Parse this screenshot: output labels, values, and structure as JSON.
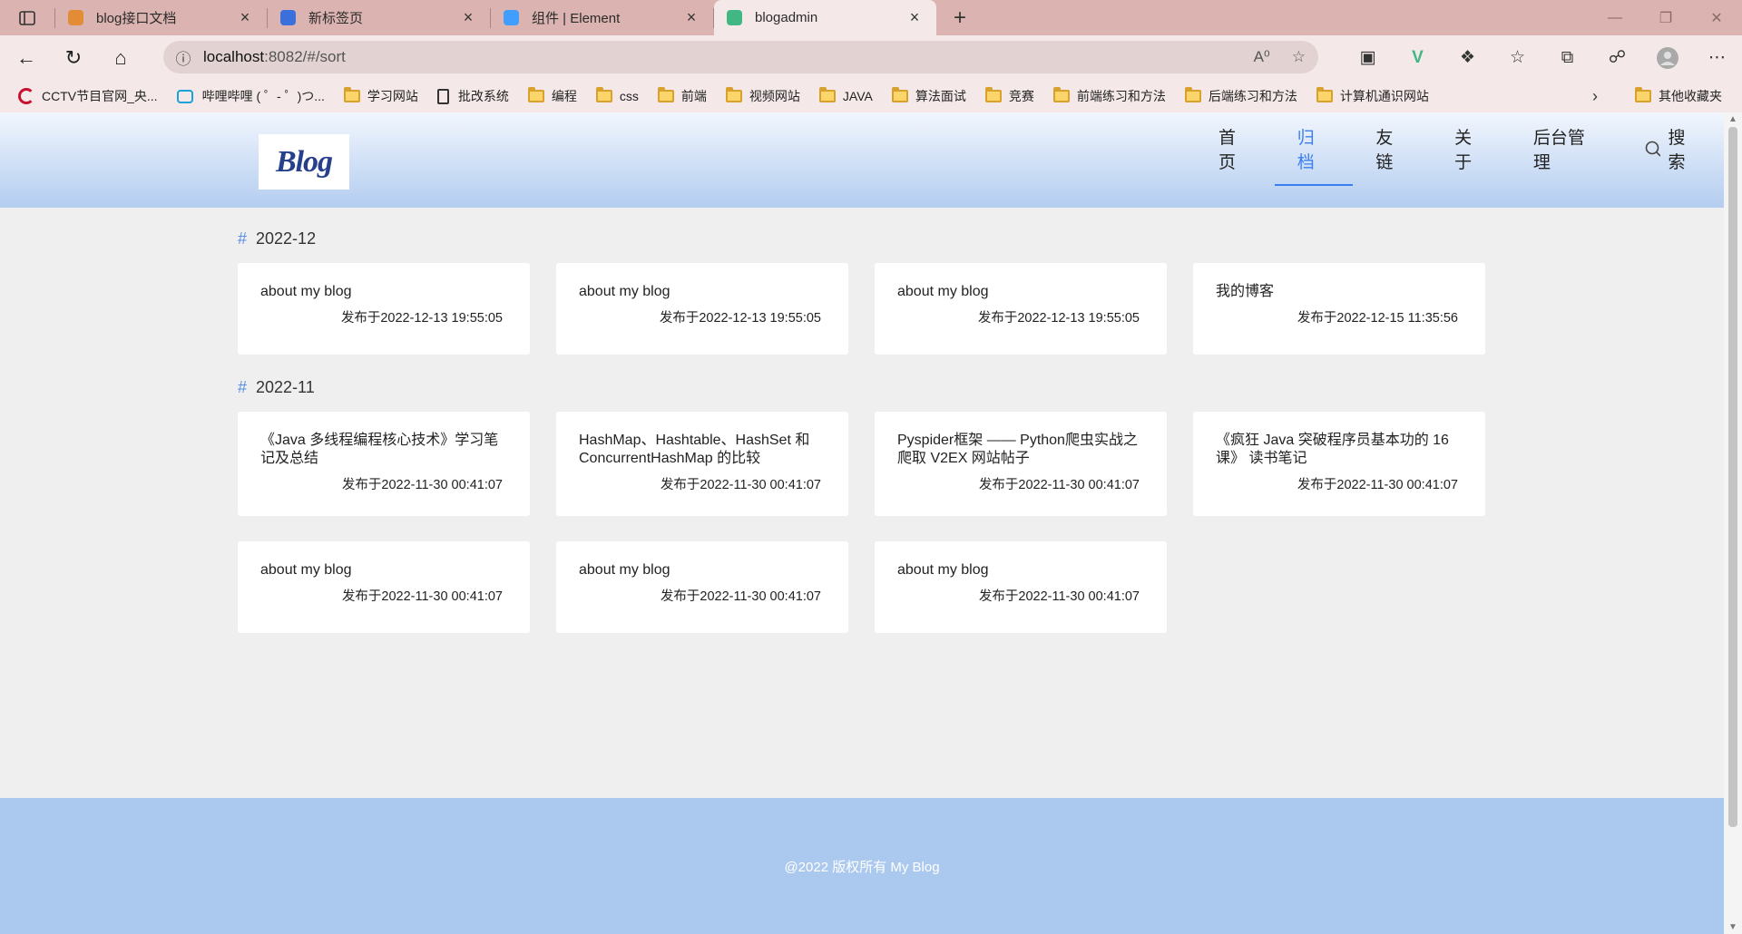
{
  "browser": {
    "tabs": [
      {
        "title": "blog接口文档",
        "active": false,
        "color": "#e28c35"
      },
      {
        "title": "新标签页",
        "active": false,
        "color": "#3a6fdc"
      },
      {
        "title": "组件 | Element",
        "active": false,
        "color": "#409eff"
      },
      {
        "title": "blogadmin",
        "active": true,
        "color": "#41b883"
      }
    ],
    "url_host": "localhost",
    "url_rest": ":8082/#/sort",
    "bookmarks": [
      {
        "label": "CCTV节目官网_央...",
        "icon": "cctv"
      },
      {
        "label": "哔哩哔哩 ( ゜- ゜)つ...",
        "icon": "bili"
      },
      {
        "label": "学习网站",
        "icon": "folder"
      },
      {
        "label": "批改系统",
        "icon": "doc"
      },
      {
        "label": "编程",
        "icon": "folder"
      },
      {
        "label": "css",
        "icon": "folder"
      },
      {
        "label": "前端",
        "icon": "folder"
      },
      {
        "label": "视频网站",
        "icon": "folder"
      },
      {
        "label": "JAVA",
        "icon": "folder"
      },
      {
        "label": "算法面试",
        "icon": "folder"
      },
      {
        "label": "竞赛",
        "icon": "folder"
      },
      {
        "label": "前端练习和方法",
        "icon": "folder"
      },
      {
        "label": "后端练习和方法",
        "icon": "folder"
      },
      {
        "label": "计算机通识网站",
        "icon": "folder"
      }
    ],
    "other_bookmarks": "其他收藏夹"
  },
  "site": {
    "logo": "Blog",
    "nav": [
      {
        "label": "首页",
        "active": false
      },
      {
        "label": "归档",
        "active": true
      },
      {
        "label": "友链",
        "active": false
      },
      {
        "label": "关于",
        "active": false
      },
      {
        "label": "后台管理",
        "active": false
      }
    ],
    "search_label": "搜索",
    "accent": "#3a7ff2"
  },
  "archive": [
    {
      "month": "2022-12",
      "posts": [
        {
          "title": "about my blog",
          "date": "发布于2022-12-13 19:55:05"
        },
        {
          "title": "about my blog",
          "date": "发布于2022-12-13 19:55:05"
        },
        {
          "title": "about my blog",
          "date": "发布于2022-12-13 19:55:05"
        },
        {
          "title": "我的博客",
          "date": "发布于2022-12-15 11:35:56"
        }
      ]
    },
    {
      "month": "2022-11",
      "posts": [
        {
          "title": "《Java 多线程编程核心技术》学习笔记及总结",
          "date": "发布于2022-11-30 00:41:07"
        },
        {
          "title": "HashMap、Hashtable、HashSet 和 ConcurrentHashMap 的比较",
          "date": "发布于2022-11-30 00:41:07"
        },
        {
          "title": "Pyspider框架 —— Python爬虫实战之爬取 V2EX 网站帖子",
          "date": "发布于2022-11-30 00:41:07"
        },
        {
          "title": "《疯狂 Java 突破程序员基本功的 16 课》 读书笔记",
          "date": "发布于2022-11-30 00:41:07"
        },
        {
          "title": "about my blog",
          "date": "发布于2022-11-30 00:41:07"
        },
        {
          "title": "about my blog",
          "date": "发布于2022-11-30 00:41:07"
        },
        {
          "title": "about my blog",
          "date": "发布于2022-11-30 00:41:07"
        }
      ]
    }
  ],
  "footer": "@2022  版权所有 My Blog"
}
